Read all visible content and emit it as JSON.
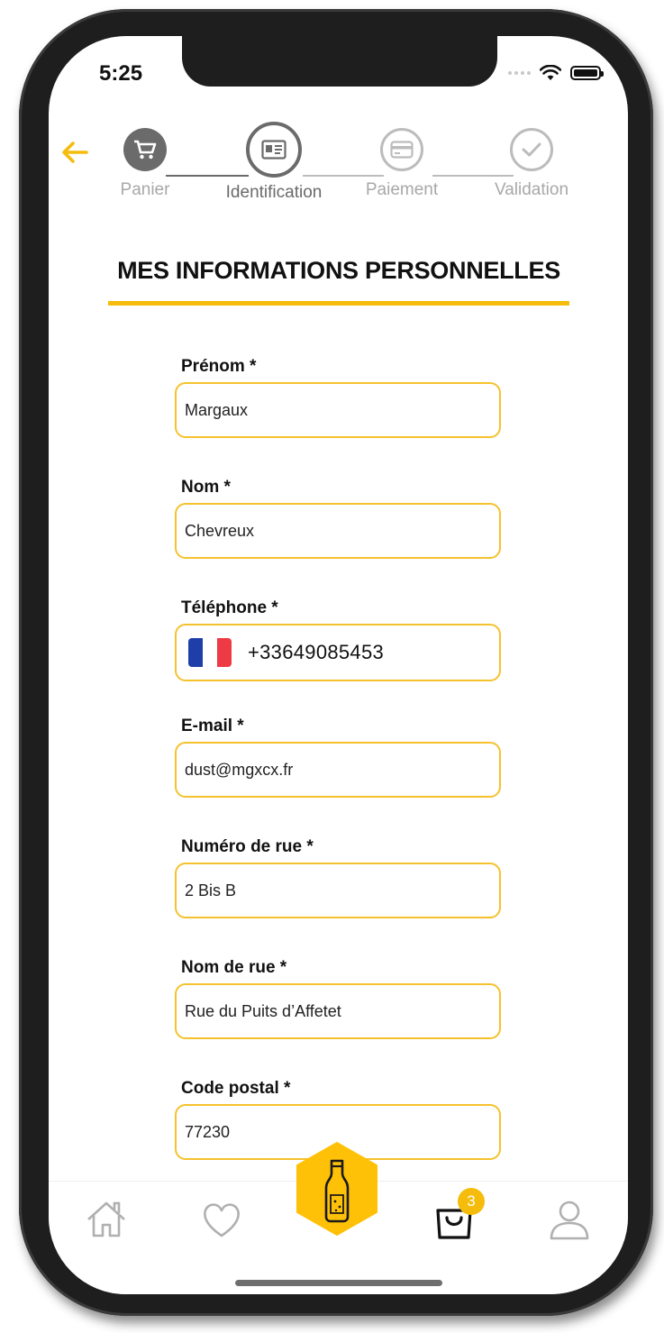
{
  "status": {
    "time": "5:25"
  },
  "colors": {
    "accent": "#f5bc0b",
    "completed_step": "#6b6b6b",
    "inactive": "#b5b5b5"
  },
  "steps": [
    {
      "label": "Panier",
      "icon": "cart-icon",
      "state": "completed"
    },
    {
      "label": "Identification",
      "icon": "id-card-icon",
      "state": "active"
    },
    {
      "label": "Paiement",
      "icon": "credit-card-icon",
      "state": "pending"
    },
    {
      "label": "Validation",
      "icon": "checkmark-icon",
      "state": "pending"
    }
  ],
  "section": {
    "title": "MES INFORMATIONS PERSONNELLES"
  },
  "form": {
    "first_name": {
      "label": "Prénom *",
      "value": "Margaux"
    },
    "last_name": {
      "label": "Nom *",
      "value": "Chevreux"
    },
    "phone": {
      "label": "Téléphone *",
      "value": "+33649085453",
      "flag": "france-flag"
    },
    "email": {
      "label": "E-mail *",
      "value": "dust@mgxcx.fr"
    },
    "street_number": {
      "label": "Numéro de rue *",
      "value": "2 Bis B"
    },
    "street_name": {
      "label": "Nom de rue *",
      "value": "Rue du Puits d’Affetet"
    },
    "postal_code": {
      "label": "Code postal *",
      "value": "77230"
    }
  },
  "tabbar": {
    "items": [
      "home-icon",
      "heart-icon",
      "bottle-icon",
      "bag-icon",
      "user-icon"
    ],
    "cart_badge": "3"
  }
}
